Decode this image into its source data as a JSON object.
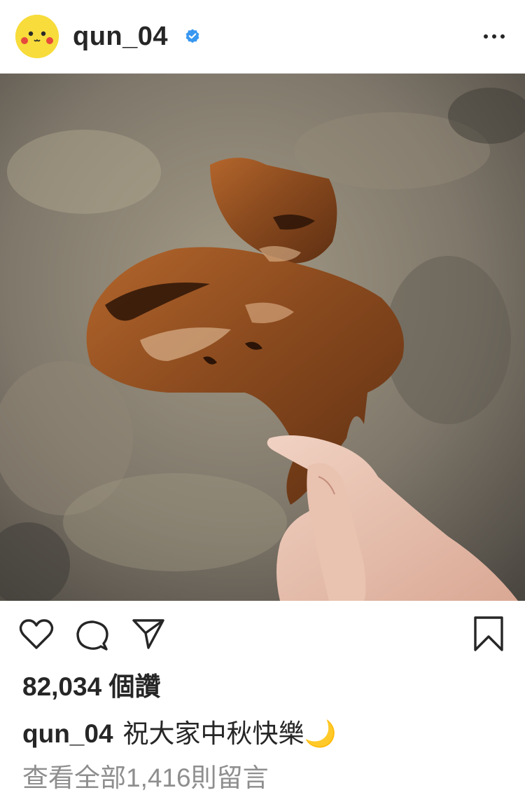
{
  "post": {
    "username": "qun_04",
    "verified": true,
    "likes_text": "82,034 個讚",
    "caption_user": "qun_04",
    "caption_text": "祝大家中秋快樂🌙",
    "view_comments_text": "查看全部1,416則留言"
  },
  "icons": {
    "avatar": "pikachu-face-icon",
    "verified": "verified-badge-icon",
    "more": "more-options-icon",
    "like": "heart-icon",
    "comment": "comment-icon",
    "share": "send-icon",
    "save": "bookmark-icon"
  },
  "colors": {
    "verified_blue": "#3897f0",
    "text": "#262626",
    "muted": "#8e8e8e",
    "avatar_yellow": "#f7dc3b"
  }
}
